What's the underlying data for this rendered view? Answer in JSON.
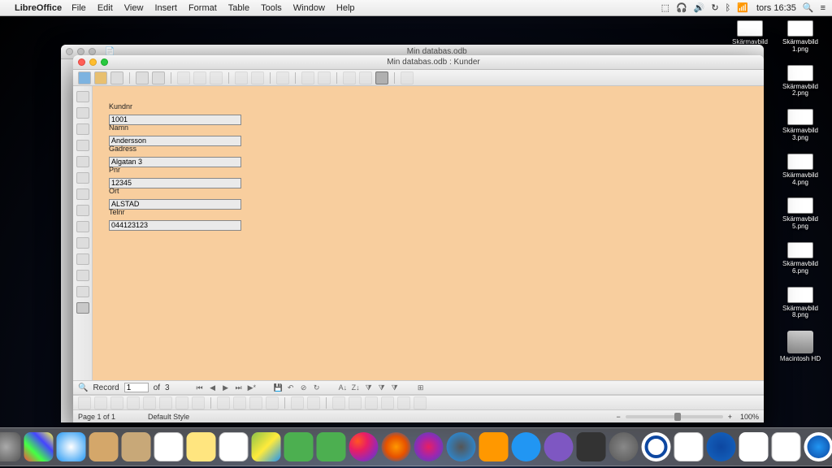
{
  "menubar": {
    "app_name": "LibreOffice",
    "items": [
      "File",
      "Edit",
      "View",
      "Insert",
      "Format",
      "Table",
      "Tools",
      "Window",
      "Help"
    ],
    "clock": "tors 16:35"
  },
  "desktop_icons": [
    "Skärmavbild 1.png",
    "Skärmavbild 2.png",
    "Skärmavbild 3.png",
    "Skärmavbild 4.png",
    "Skärmavbild 5.png",
    "Skärmavbild 6.png",
    "Skärmavbild 8.png",
    "Macintosh HD"
  ],
  "desktop_icons_col2": [
    "Skärmavbild ?.png"
  ],
  "base_window": {
    "title": "Min databas.odb"
  },
  "form_window": {
    "title": "Min databas.odb : Kunder"
  },
  "fields": {
    "kundnr": {
      "label": "Kundnr",
      "value": "1001"
    },
    "namn": {
      "label": "Namn",
      "value": "Andersson"
    },
    "gadress": {
      "label": "Gadress",
      "value": "Algatan 3"
    },
    "pnr": {
      "label": "Pnr",
      "value": "12345"
    },
    "ort": {
      "label": "Ort",
      "value": "ALSTAD"
    },
    "telnr": {
      "label": "Telnr",
      "value": "044123123"
    }
  },
  "record_nav": {
    "label": "Record",
    "current": "1",
    "of_label": "of",
    "total": "3"
  },
  "status": {
    "page": "Page 1 of 1",
    "style": "Default Style",
    "zoom": "100%"
  }
}
